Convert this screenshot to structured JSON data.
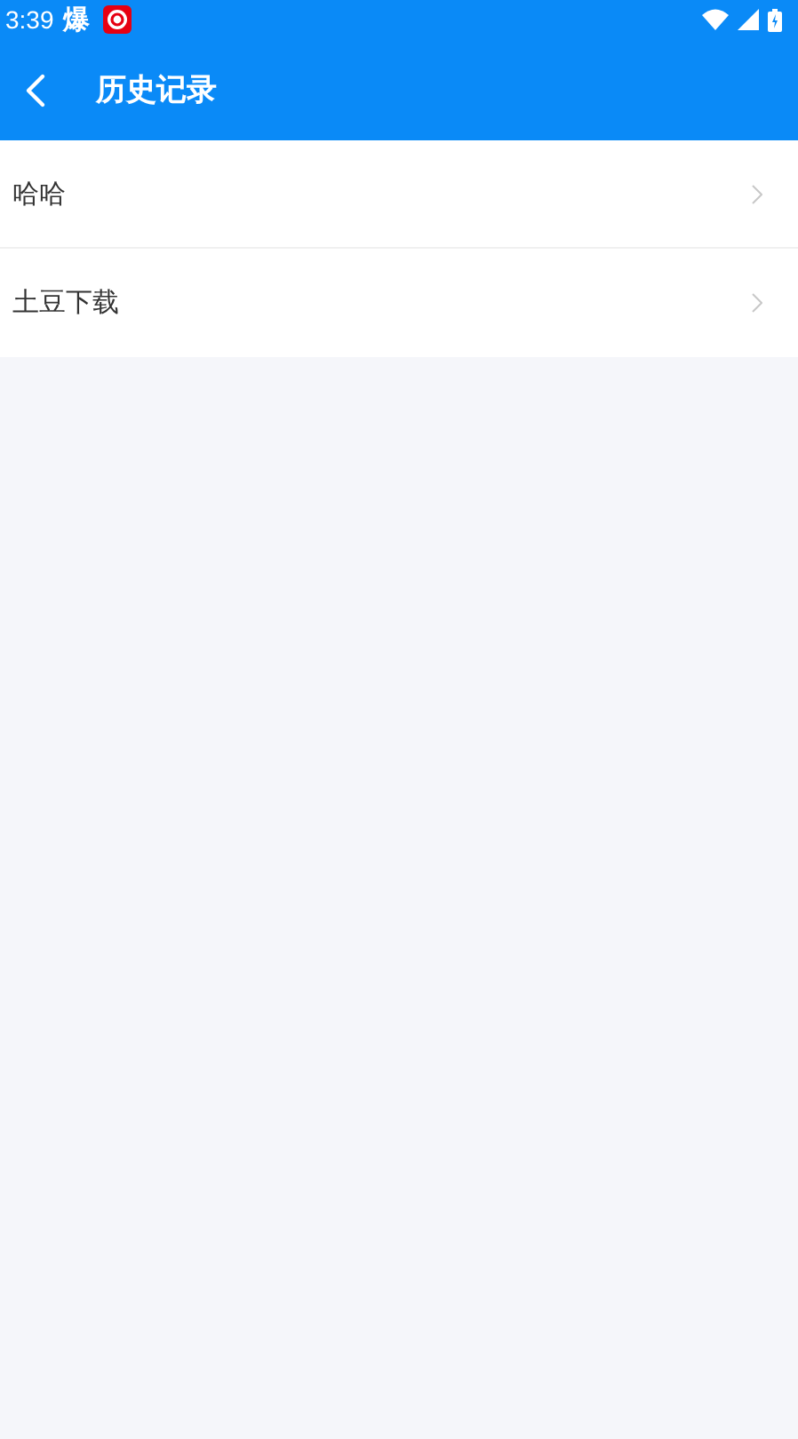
{
  "status_bar": {
    "time": "3:39",
    "notification_char": "爆"
  },
  "header": {
    "title": "历史记录"
  },
  "items": [
    {
      "label": "哈哈"
    },
    {
      "label": "土豆下载"
    }
  ]
}
